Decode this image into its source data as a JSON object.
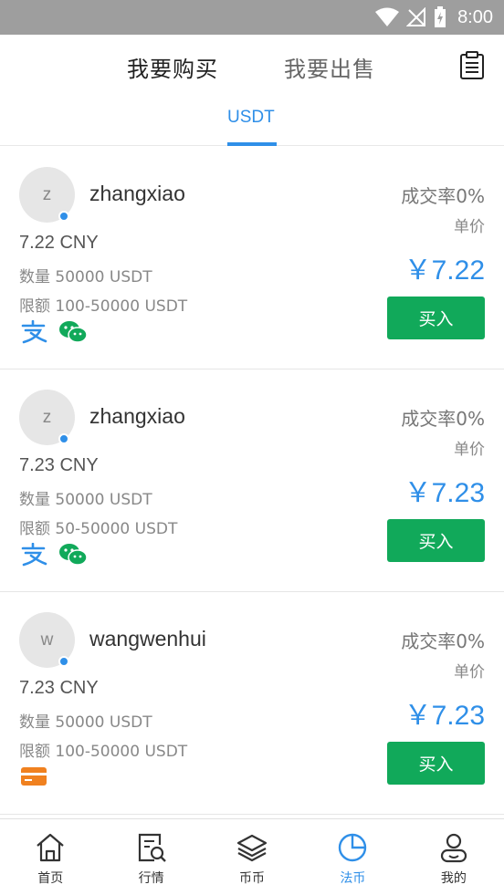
{
  "status_bar": {
    "time": "8:00"
  },
  "top_nav": {
    "buy_tab": "我要购买",
    "sell_tab": "我要出售",
    "orders_icon": "clipboard-list-icon"
  },
  "sub_tabs": {
    "active": "USDT"
  },
  "colors": {
    "accent_blue": "#2f8fe8",
    "buy_green": "#11a95a",
    "status_bar": "#9e9e9e"
  },
  "listings": [
    {
      "avatar_letter": "z",
      "username": "zhangxiao",
      "price_cny": "7.22 CNY",
      "quantity": "数量 50000 USDT",
      "limit": "限额 100-50000 USDT",
      "success_rate": "成交率0%",
      "unit_price_label": "单价",
      "unit_price": "￥7.22",
      "buy_label": "买入",
      "payment_methods": [
        "alipay-icon",
        "wechat-icon"
      ]
    },
    {
      "avatar_letter": "z",
      "username": "zhangxiao",
      "price_cny": "7.23 CNY",
      "quantity": "数量 50000 USDT",
      "limit": "限额 50-50000 USDT",
      "success_rate": "成交率0%",
      "unit_price_label": "单价",
      "unit_price": "￥7.23",
      "buy_label": "买入",
      "payment_methods": [
        "alipay-icon",
        "wechat-icon"
      ]
    },
    {
      "avatar_letter": "w",
      "username": "wangwenhui",
      "price_cny": "7.23 CNY",
      "quantity": "数量 50000 USDT",
      "limit": "限额 100-50000 USDT",
      "success_rate": "成交率0%",
      "unit_price_label": "单价",
      "unit_price": "￥7.23",
      "buy_label": "买入",
      "payment_methods": [
        "bank-card-icon"
      ]
    }
  ],
  "bottom_nav": [
    {
      "label": "首页",
      "icon": "home-icon",
      "active": false
    },
    {
      "label": "行情",
      "icon": "market-search-icon",
      "active": false
    },
    {
      "label": "币币",
      "icon": "layers-icon",
      "active": false
    },
    {
      "label": "法币",
      "icon": "pie-clock-icon",
      "active": true
    },
    {
      "label": "我的",
      "icon": "user-icon",
      "active": false
    }
  ]
}
